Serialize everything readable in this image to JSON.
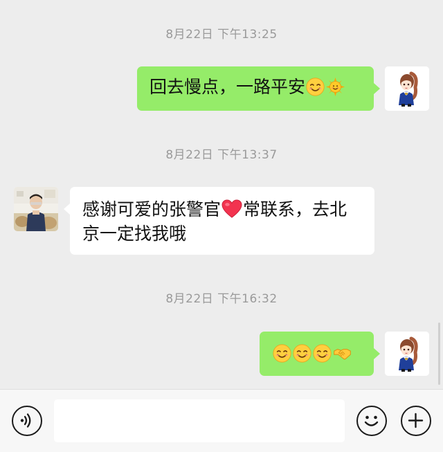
{
  "messages": [
    {
      "timestamp": "8月22日 下午13:25",
      "direction": "outgoing",
      "text": "回去慢点，一路平安",
      "emoji": [
        "smiling-face-icon",
        "sun-icon"
      ]
    },
    {
      "timestamp": "8月22日 下午13:37",
      "direction": "incoming",
      "line1_before": "感谢可爱的张警官",
      "line1_after": "常联系，去北",
      "line2": "京一定找我哦",
      "emoji": [
        "red-heart-icon"
      ]
    },
    {
      "timestamp": "8月22日 下午16:32",
      "direction": "outgoing",
      "text": "",
      "emoji": [
        "smiling-face-icon",
        "smiling-face-icon",
        "smiling-face-icon",
        "handshake-icon"
      ]
    }
  ],
  "input": {
    "value": "",
    "placeholder": ""
  },
  "colors": {
    "background": "#ededed",
    "outgoing_bubble": "#95ec69",
    "incoming_bubble": "#ffffff",
    "timestamp_text": "#9a9a9a"
  },
  "icons": {
    "voice": "voice-input-icon",
    "emoji": "emoji-icon",
    "more": "plus-icon"
  }
}
